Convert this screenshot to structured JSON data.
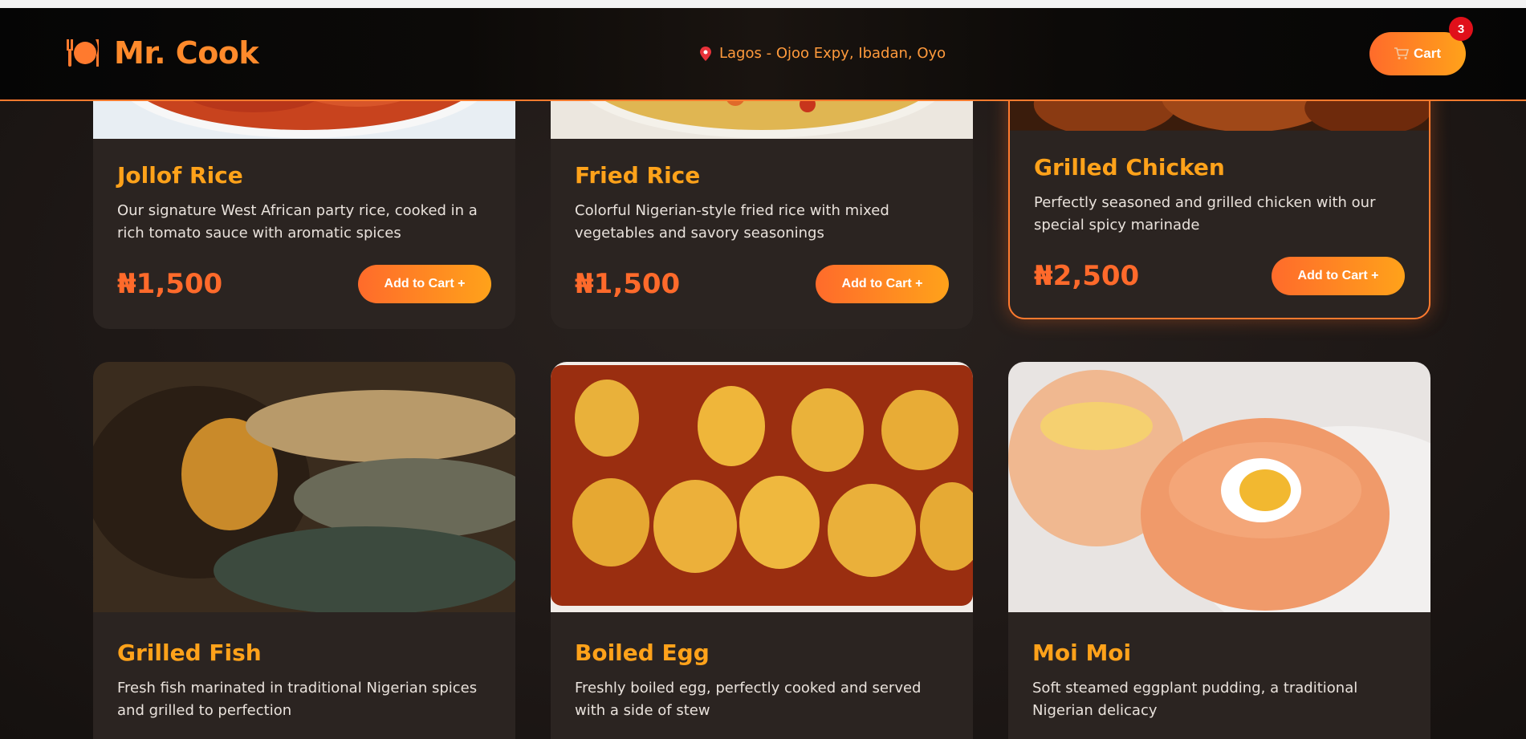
{
  "header": {
    "brand_name": "Mr. Cook",
    "brand_icon": "utensils-plate-icon",
    "location_icon": "map-pin-icon",
    "location": "Lagos - Ojoo Expy, Ibadan, Oyo",
    "cart_icon": "shopping-cart-icon",
    "cart_label": "Cart",
    "cart_count": "3"
  },
  "colors": {
    "accent": "#ff7a2e",
    "title": "#ffa21a",
    "price": "#ff6a2b",
    "card_bg": "#2b2421",
    "badge": "#e0101a"
  },
  "menu": [
    {
      "title": "Jollof Rice",
      "description": "Our signature West African party rice, cooked in a rich tomato sauce with aromatic spices",
      "price": "₦1,500",
      "button": "Add to Cart +"
    },
    {
      "title": "Fried Rice",
      "description": "Colorful Nigerian-style fried rice with mixed vegetables and savory seasonings",
      "price": "₦1,500",
      "button": "Add to Cart +"
    },
    {
      "title": "Grilled Chicken",
      "description": "Perfectly seasoned and grilled chicken with our special spicy marinade",
      "price": "₦2,500",
      "button": "Add to Cart +"
    },
    {
      "title": "Grilled Fish",
      "description": "Fresh fish marinated in traditional Nigerian spices and grilled to perfection"
    },
    {
      "title": "Boiled Egg",
      "description": "Freshly boiled egg, perfectly cooked and served with a side of stew"
    },
    {
      "title": "Moi Moi",
      "description": "Soft steamed eggplant pudding, a traditional Nigerian delicacy"
    }
  ]
}
